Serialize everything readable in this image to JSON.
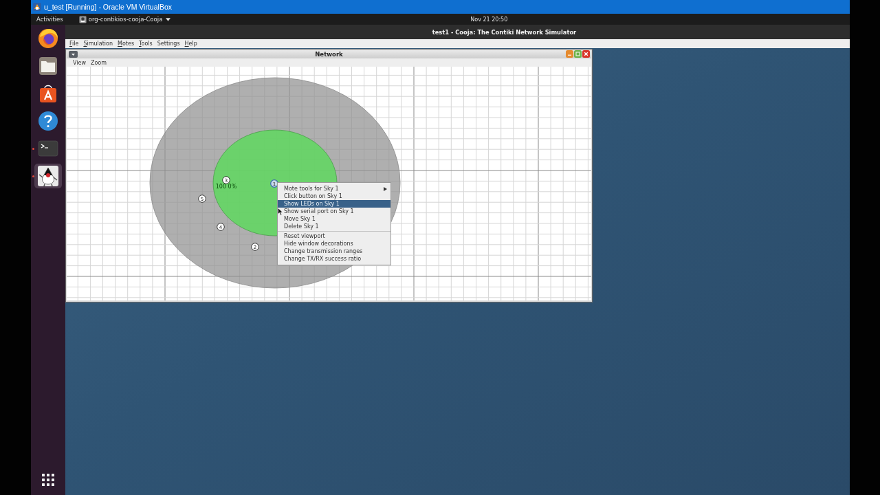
{
  "host_window": {
    "title": "u_test [Running] - Oracle VM VirtualBox"
  },
  "top_bar": {
    "activities": "Activities",
    "app_menu": "org-contikios-cooja-Cooja",
    "clock": "Nov 21 20:50"
  },
  "dock": {
    "items": [
      {
        "kind": "browser",
        "running": false,
        "selected": false
      },
      {
        "kind": "files",
        "running": false,
        "selected": false
      },
      {
        "kind": "software",
        "running": false,
        "selected": false
      },
      {
        "kind": "help",
        "running": false,
        "selected": false
      },
      {
        "kind": "terminal",
        "running": true,
        "selected": false
      },
      {
        "kind": "mascot",
        "running": true,
        "selected": true
      }
    ]
  },
  "app_window": {
    "title": "test1 - Cooja: The Contiki Network Simulator",
    "menu": [
      {
        "label": "File",
        "mnemonic": true
      },
      {
        "label": "Simulation",
        "mnemonic": true
      },
      {
        "label": "Motes",
        "mnemonic": true
      },
      {
        "label": "Tools",
        "mnemonic": true
      },
      {
        "label": "Settings",
        "mnemonic": false
      },
      {
        "label": "Help",
        "mnemonic": true
      }
    ]
  },
  "network_window": {
    "title": "Network",
    "menu": [
      "View",
      "Zoom"
    ],
    "motes": [
      {
        "label": "1",
        "selected": true
      },
      {
        "label": "2",
        "selected": false
      },
      {
        "label": "3",
        "selected": false,
        "ratio": "100 0%"
      },
      {
        "label": "4",
        "selected": false
      },
      {
        "label": "5",
        "selected": false
      }
    ],
    "context_menu": {
      "sections": [
        {
          "items": [
            {
              "label": "Mote tools for Sky 1",
              "submenu": true,
              "selected": false
            },
            {
              "label": "Click button on Sky 1",
              "submenu": false,
              "selected": false
            },
            {
              "label": "Show LEDs on Sky 1",
              "submenu": false,
              "selected": true
            },
            {
              "label": "Show serial port on Sky 1",
              "submenu": false,
              "selected": false
            },
            {
              "label": "Move Sky 1",
              "submenu": false,
              "selected": false
            },
            {
              "label": "Delete Sky 1",
              "submenu": false,
              "selected": false
            }
          ]
        },
        {
          "items": [
            {
              "label": "Reset viewport",
              "submenu": false,
              "selected": false
            },
            {
              "label": "Hide window decorations",
              "submenu": false,
              "selected": false
            },
            {
              "label": "Change transmission ranges",
              "submenu": false,
              "selected": false
            },
            {
              "label": "Change TX/RX success ratio",
              "submenu": false,
              "selected": false
            }
          ]
        }
      ]
    }
  }
}
